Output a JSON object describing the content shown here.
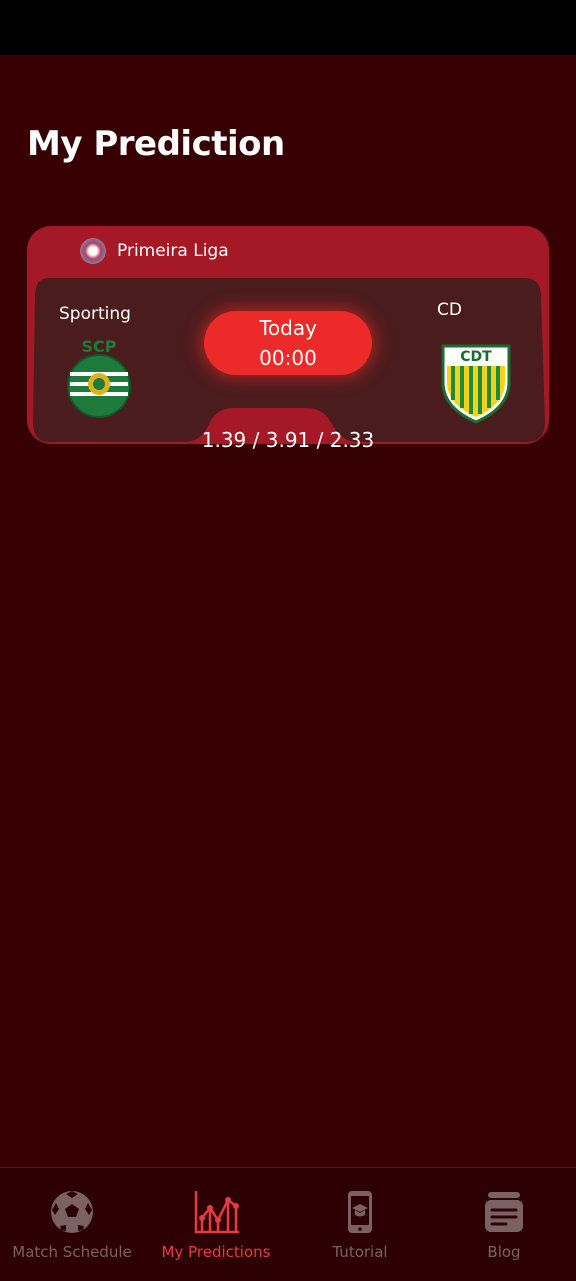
{
  "page": {
    "title": "My Prediction"
  },
  "match": {
    "league": "Primeira Liga",
    "league_flag_icon": "portugal-league-icon",
    "home_team": "Sporting",
    "away_team": "CD",
    "home_logo_text": "SCP",
    "away_logo_text": "CDT",
    "day": "Today",
    "time": "00:00",
    "odds": "1.39 / 3.91 / 2.33"
  },
  "nav": {
    "items": [
      {
        "label": "Match Schedule",
        "icon": "soccer-ball-icon",
        "active": false
      },
      {
        "label": "My Predictions",
        "icon": "chart-icon",
        "active": true
      },
      {
        "label": "Tutorial",
        "icon": "phone-graduation-icon",
        "active": false
      },
      {
        "label": "Blog",
        "icon": "document-icon",
        "active": false
      }
    ]
  },
  "colors": {
    "background": "#370003",
    "card": "#a41925",
    "card_inner": "#4a1c1d",
    "accent": "#ec2a2a",
    "nav_inactive": "#7a6263",
    "nav_active": "#e83a3f"
  }
}
